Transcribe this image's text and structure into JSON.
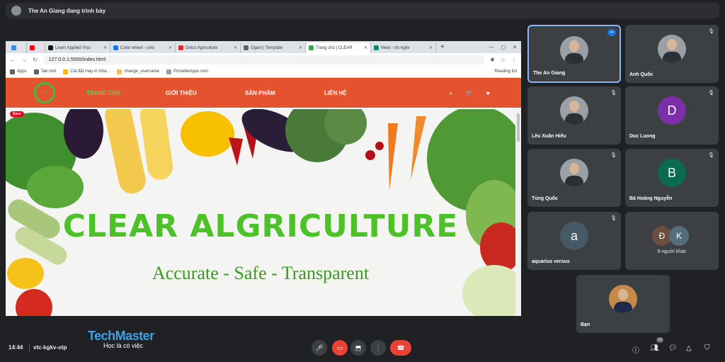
{
  "presenting": {
    "text": "The An Giang đang trình bày"
  },
  "browser": {
    "tabs": [
      {
        "title": "",
        "color": "#4285f4"
      },
      {
        "title": "",
        "color": "#ff0000"
      },
      {
        "title": "Learn Applied Visu",
        "color": "#111111"
      },
      {
        "title": "Color wheel - colo",
        "color": "#1a73e8"
      },
      {
        "title": "Delco Agriculture",
        "color": "#d93025"
      },
      {
        "title": "Ogani | Template",
        "color": "#5f6368"
      },
      {
        "title": "Trang chủ | CLEAR",
        "color": "#34a853"
      },
      {
        "title": "Meet - vtc-kgkv",
        "color": "#00897b"
      }
    ],
    "url": "127.0.0.1:5500/index.html",
    "bookmarks": [
      {
        "label": "Apps",
        "color": "#5f6368"
      },
      {
        "label": "Tab mới",
        "color": "#5f6368"
      },
      {
        "label": "Cài đặt máy in Hóa...",
        "color": "#fbbc04"
      },
      {
        "label": "change_username",
        "color": "#f4c542"
      },
      {
        "label": "PortableApps.com",
        "color": "#9aa0a6"
      }
    ],
    "reading_list": "Reading list"
  },
  "site": {
    "nav": [
      "TRANG CHỦ",
      "GIỚI THIỆU",
      "SẢN PHẨM",
      "LIÊN HỆ"
    ],
    "save_label": "Save",
    "hero_title": "CLEAR ALGRICULTURE",
    "hero_subtitle": "Accurate - Safe - Transparent"
  },
  "participants": [
    {
      "name": "The An Giang",
      "type": "photo",
      "speaking": true
    },
    {
      "name": "Anh Quốc",
      "type": "photo",
      "speaking": false
    },
    {
      "name": "Lều Xuân Hiếu",
      "type": "photo",
      "speaking": false
    },
    {
      "name": "Duc Luong",
      "type": "letter",
      "letter": "D",
      "color": "#7b2fa8"
    },
    {
      "name": "Tùng Quốc",
      "type": "photo",
      "speaking": false
    },
    {
      "name": "Bá Hoàng Nguyễn",
      "type": "letter",
      "letter": "B",
      "color": "#0b6b4f"
    },
    {
      "name": "aquarius versus",
      "type": "letter",
      "letter": "a",
      "color": "#455a64"
    }
  ],
  "others": {
    "letters": [
      "Đ",
      "K"
    ],
    "colors": [
      "#6d4c41",
      "#546e7a"
    ],
    "label": "9 người khác"
  },
  "self": {
    "name": "Bạn"
  },
  "bottom": {
    "time": "14:44",
    "meeting_code": "vtc-kgkv-otp",
    "brand": "TechMaster",
    "tagline": "Học là có việc",
    "participant_count": "18"
  }
}
